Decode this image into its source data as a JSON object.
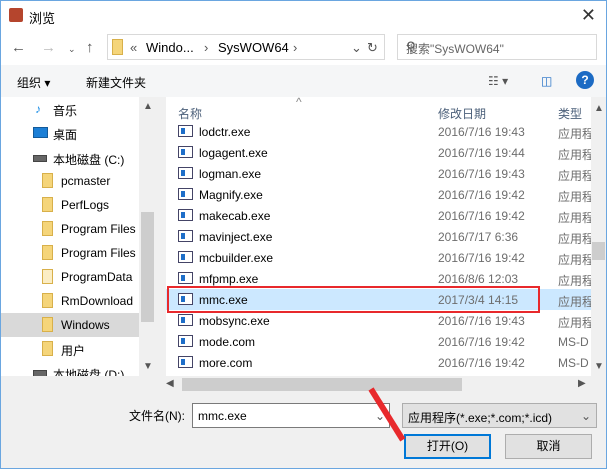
{
  "title": "浏览",
  "address": {
    "crumbs": [
      "«",
      "Windo...",
      "›",
      "SysWOW64",
      "›"
    ]
  },
  "search": {
    "placeholder": "搜索\"SysWOW64\""
  },
  "toolbar": {
    "organize": "组织 ▾",
    "new_folder": "新建文件夹",
    "help": "?"
  },
  "sidebar": {
    "items": [
      {
        "label": "音乐",
        "icon": "music-icon"
      },
      {
        "label": "桌面",
        "icon": "desktop-icon"
      },
      {
        "label": "本地磁盘 (C:)",
        "icon": "drive-icon"
      },
      {
        "label": "pcmaster",
        "icon": "folder-icon"
      },
      {
        "label": "PerfLogs",
        "icon": "folder-icon"
      },
      {
        "label": "Program Files",
        "icon": "folder-icon"
      },
      {
        "label": "Program Files",
        "icon": "folder-icon"
      },
      {
        "label": "ProgramData",
        "icon": "folder-icon"
      },
      {
        "label": "RmDownload",
        "icon": "folder-icon"
      },
      {
        "label": "Windows",
        "icon": "folder-icon",
        "selected": true
      },
      {
        "label": "用户",
        "icon": "folder-icon"
      },
      {
        "label": "本地磁盘 (D:)",
        "icon": "drive-icon"
      }
    ]
  },
  "columns": {
    "name": "名称",
    "date": "修改日期",
    "type": "类型"
  },
  "files": [
    {
      "name": "lodctr.exe",
      "date": "2016/7/16 19:43",
      "type": "应用程"
    },
    {
      "name": "logagent.exe",
      "date": "2016/7/16 19:44",
      "type": "应用程"
    },
    {
      "name": "logman.exe",
      "date": "2016/7/16 19:43",
      "type": "应用程"
    },
    {
      "name": "Magnify.exe",
      "date": "2016/7/16 19:42",
      "type": "应用程"
    },
    {
      "name": "makecab.exe",
      "date": "2016/7/16 19:42",
      "type": "应用程"
    },
    {
      "name": "mavinject.exe",
      "date": "2016/7/17 6:36",
      "type": "应用程"
    },
    {
      "name": "mcbuilder.exe",
      "date": "2016/7/16 19:42",
      "type": "应用程"
    },
    {
      "name": "mfpmp.exe",
      "date": "2016/8/6 12:03",
      "type": "应用程"
    },
    {
      "name": "mmc.exe",
      "date": "2017/3/4 14:15",
      "type": "应用程",
      "selected": true
    },
    {
      "name": "mobsync.exe",
      "date": "2016/7/16 19:43",
      "type": "应用程"
    },
    {
      "name": "mode.com",
      "date": "2016/7/16 19:42",
      "type": "MS-D"
    },
    {
      "name": "more.com",
      "date": "2016/7/16 19:42",
      "type": "MS-D"
    }
  ],
  "footer": {
    "filename_label": "文件名(N):",
    "filename_value": "mmc.exe",
    "filetype": "应用程序(*.exe;*.com;*.icd)",
    "open": "打开(O)",
    "cancel": "取消"
  },
  "colors": {
    "highlight": "#e8292c",
    "selection": "#cce8ff",
    "accent": "#0078d7"
  }
}
